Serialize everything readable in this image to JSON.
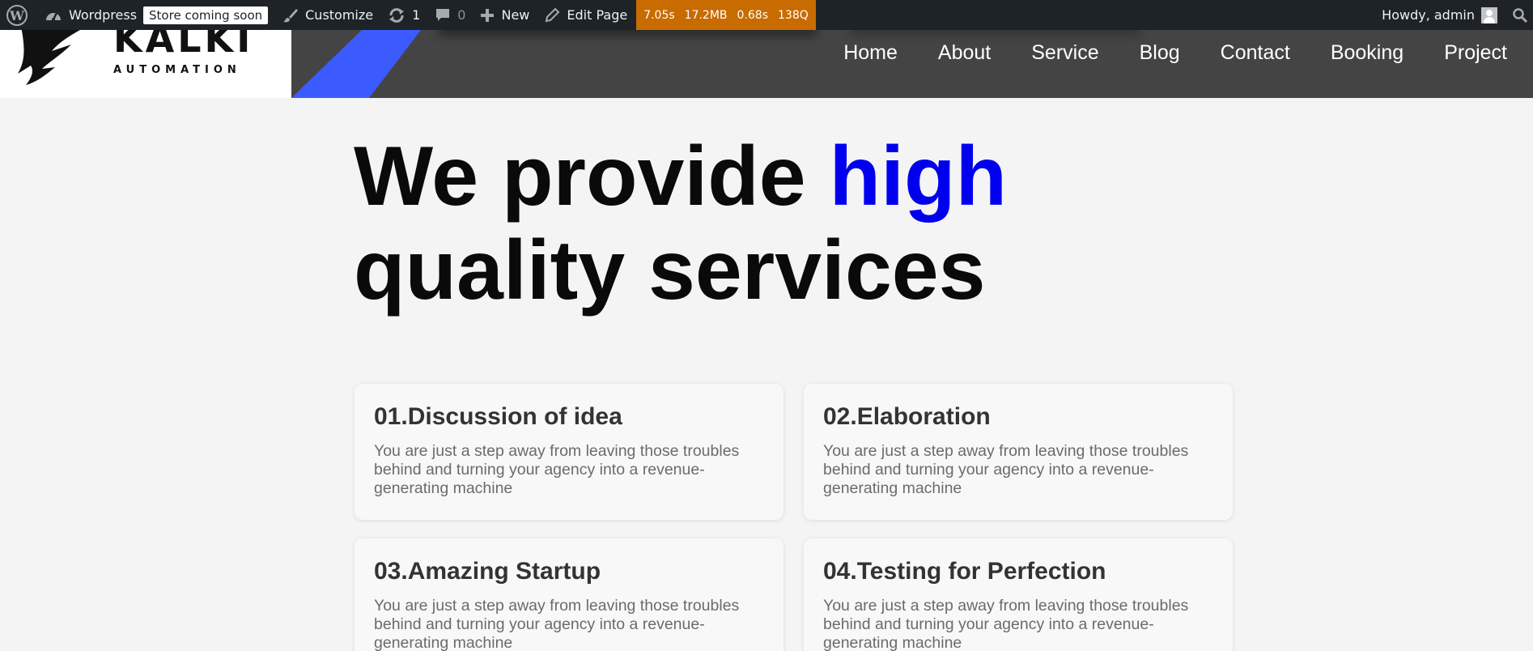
{
  "admin_bar": {
    "site_name": "Wordpress",
    "store_badge": "Store coming soon",
    "customize": "Customize",
    "updates_count": "1",
    "comments_count": "0",
    "new_label": "New",
    "edit_page": "Edit Page",
    "query_monitor": [
      "7.05s",
      "17.2MB",
      "0.68s",
      "138Q"
    ],
    "howdy": "Howdy, admin",
    "accent_color": "#c86b00"
  },
  "header": {
    "logo_text": "KALKI",
    "logo_subtext": "AUTOMATION",
    "nav": [
      "Home",
      "About",
      "Service",
      "Blog",
      "Contact",
      "Booking",
      "Project"
    ],
    "accent_color": "#3b5bff"
  },
  "hero": {
    "title_part1": "We provide ",
    "title_accent": "high",
    "title_part2": "quality services",
    "accent_color": "#0000ee"
  },
  "cards": [
    {
      "title": "01.Discussion of idea",
      "text": "You are just a step away from leaving those troubles behind and turning your agency into a revenue-generating machine"
    },
    {
      "title": "02.Elaboration",
      "text": "You are just a step away from leaving those troubles behind and turning your agency into a revenue-generating machine"
    },
    {
      "title": "03.Amazing Startup",
      "text": "You are just a step away from leaving those troubles behind and turning your agency into a revenue-generating machine"
    },
    {
      "title": "04.Testing for Perfection",
      "text": "You are just a step away from leaving those troubles behind and turning your agency into a revenue-generating machine"
    }
  ]
}
